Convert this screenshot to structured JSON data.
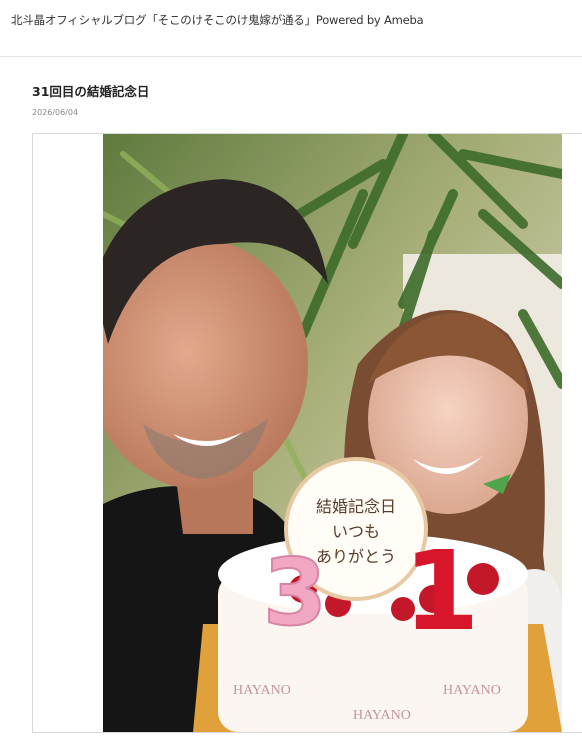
{
  "header": {
    "blog_title": "北斗晶オフィシャルブログ「そこのけそこのけ鬼嫁が通る」Powered by Ameba"
  },
  "entry": {
    "title": "31回目の結婚記念日",
    "date": "2026/06/04",
    "photo": {
      "cake_plaque_lines": [
        "結婚記念日",
        "いつも",
        "ありがとう"
      ],
      "candle_digits": [
        "3",
        "1"
      ],
      "cake_brand": "HAYANO"
    }
  }
}
